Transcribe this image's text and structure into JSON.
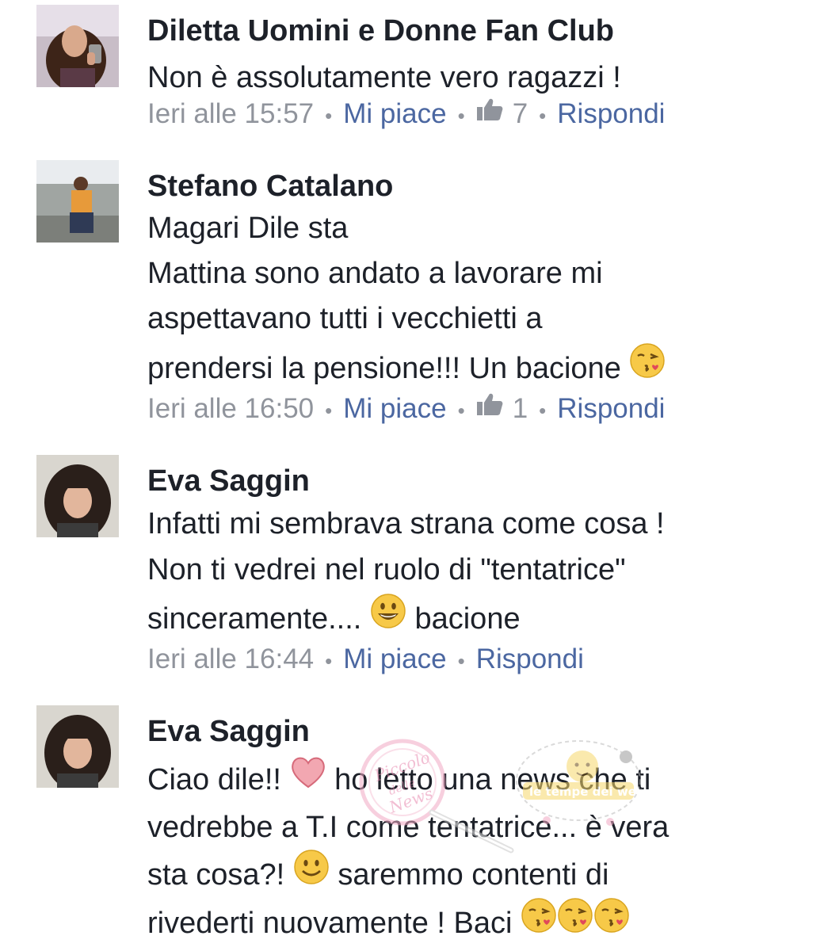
{
  "colors": {
    "text": "#1d2129",
    "meta": "#90949c",
    "action": "#4b67a1",
    "emoji_face": "#f7c948"
  },
  "comments": [
    {
      "author": "Diletta Uomini e Donne Fan Club",
      "lines": [
        "Non è assolutamente vero ragazzi !"
      ],
      "timestamp": "Ieri alle 15:57",
      "like_label": "Mi piace",
      "like_icon": "thumbs-up-icon",
      "like_count": "7",
      "reply_label": "Rispondi"
    },
    {
      "author": "Stefano Catalano",
      "lines": [
        "Magari Dile sta",
        "Mattina sono andato a lavorare mi",
        "aspettavano tutti i vecchietti a",
        "prendersi la pensione!!! Un bacione"
      ],
      "line_end_emoji": "kiss-face-icon",
      "timestamp": "Ieri alle 16:50",
      "like_label": "Mi piace",
      "like_icon": "thumbs-up-icon",
      "like_count": "1",
      "reply_label": "Rispondi"
    },
    {
      "author": "Eva Saggin",
      "lines": [
        "Infatti mi sembrava strana come cosa !",
        "Non ti vedrei nel ruolo di \"tentatrice\"",
        "sinceramente....",
        "bacione"
      ],
      "inline_emoji": "grinning-face-icon",
      "timestamp": "Ieri alle 16:44",
      "like_label": "Mi piace",
      "reply_label": "Rispondi"
    },
    {
      "author": "Eva Saggin",
      "lines": [
        "Ciao dile!!",
        "ho letto una news che ti",
        "vedrebbe a T.I come tentatrice... è vera",
        "sta cosa?!",
        "saremmo contenti di",
        "rivederti nuovamente ! Baci"
      ],
      "inline_emojis": [
        "heart-icon",
        "smiling-face-icon",
        "kiss-face-icon"
      ]
    }
  ],
  "watermark": {
    "left_text": "Piccolo delle News",
    "right_text": "le tempe dei web"
  }
}
